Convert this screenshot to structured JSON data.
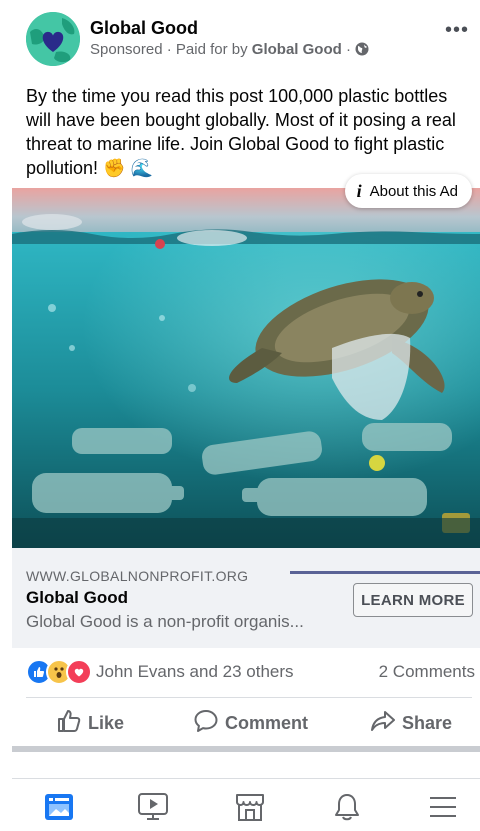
{
  "post": {
    "page_name": "Global Good",
    "sponsored": "Sponsored",
    "paid_for_prefix": "Paid for by",
    "payer": "Global Good",
    "separator": "·",
    "more_label": "•••",
    "text": "By the time you read this post 100,000 plastic bottles will have been bought globally. Most of it posing a real threat to marine life. Join Global Good to fight plastic pollution! ✊ 🌊"
  },
  "media": {
    "about_ad_icon": "info-icon",
    "about_ad_label": "About this Ad"
  },
  "link": {
    "domain": "WWW.GLOBALNONPROFIT.ORG",
    "title": "Global Good",
    "description": "Global Good is a non-profit organis...",
    "cta_label": "LEARN MORE"
  },
  "engagement": {
    "reaction_icons": [
      "like-icon",
      "wow-icon",
      "love-icon"
    ],
    "reacted_by": "John Evans and 23 others",
    "comments": "2 Comments"
  },
  "actions": {
    "like_label": "Like",
    "comment_label": "Comment",
    "share_label": "Share"
  },
  "tabbar": {
    "items": [
      "news-feed-icon",
      "watch-icon",
      "marketplace-icon",
      "notifications-icon",
      "menu-icon"
    ],
    "active_color": "#1877f2"
  }
}
